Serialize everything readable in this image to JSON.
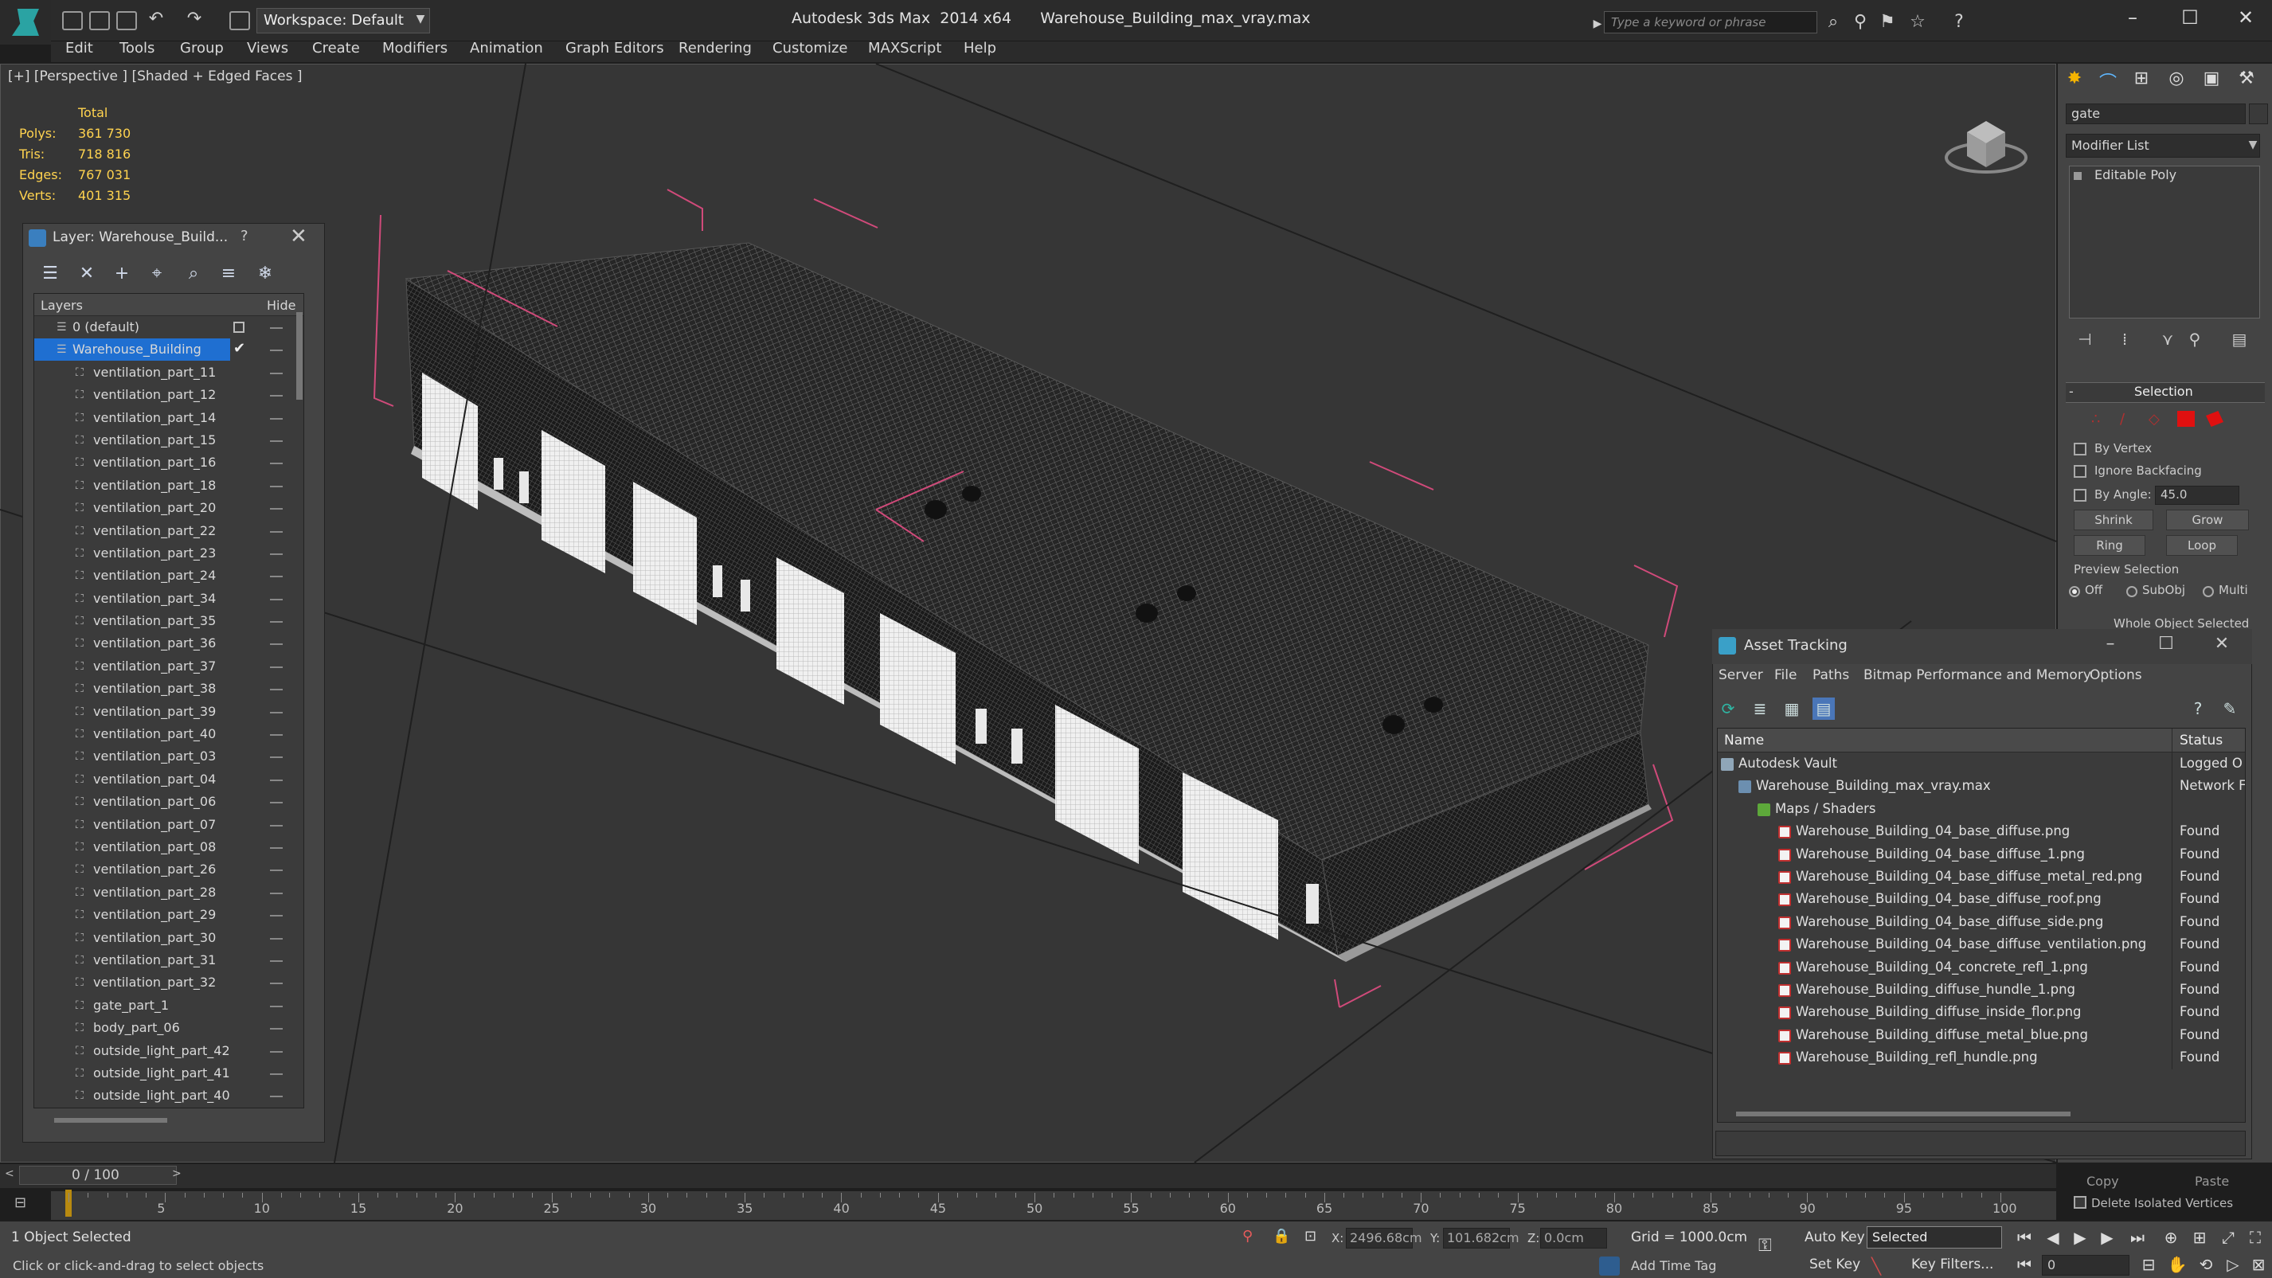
{
  "titlebar": {
    "workspace": "Workspace: Default",
    "title": "Autodesk 3ds Max  2014 x64      Warehouse_Building_max_vray.max",
    "search_placeholder": "Type a keyword or phrase",
    "minimize": "–",
    "maximize": "☐",
    "close": "✕"
  },
  "menu": [
    "Edit",
    "Tools",
    "Group",
    "Views",
    "Create",
    "Modifiers",
    "Animation",
    "Graph Editors",
    "Rendering",
    "Customize",
    "MAXScript",
    "Help"
  ],
  "viewport": {
    "label": "[+] [Perspective ] [Shaded + Edged Faces ]",
    "stats": {
      "header": "Total",
      "rows": [
        {
          "label": "Polys:",
          "value": "361 730"
        },
        {
          "label": "Tris:",
          "value": "718 816"
        },
        {
          "label": "Edges:",
          "value": "767 031"
        },
        {
          "label": "Verts:",
          "value": "401 315"
        }
      ]
    }
  },
  "layer_panel": {
    "title": "Layer: Warehouse_Build...",
    "help": "?",
    "close": "✕",
    "col_layers": "Layers",
    "col_hide": "Hide",
    "top_layers": [
      {
        "name": "0 (default)",
        "selected": false
      },
      {
        "name": "Warehouse_Building",
        "selected": true
      }
    ],
    "items": [
      "ventilation_part_11",
      "ventilation_part_12",
      "ventilation_part_14",
      "ventilation_part_15",
      "ventilation_part_16",
      "ventilation_part_18",
      "ventilation_part_20",
      "ventilation_part_22",
      "ventilation_part_23",
      "ventilation_part_24",
      "ventilation_part_34",
      "ventilation_part_35",
      "ventilation_part_36",
      "ventilation_part_37",
      "ventilation_part_38",
      "ventilation_part_39",
      "ventilation_part_40",
      "ventilation_part_03",
      "ventilation_part_04",
      "ventilation_part_06",
      "ventilation_part_07",
      "ventilation_part_08",
      "ventilation_part_26",
      "ventilation_part_28",
      "ventilation_part_29",
      "ventilation_part_30",
      "ventilation_part_31",
      "ventilation_part_32",
      "gate_part_1",
      "body_part_06",
      "outside_light_part_42",
      "outside_light_part_41",
      "outside_light_part_40"
    ]
  },
  "command_panel": {
    "object_name": "gate",
    "modifier_list": "Modifier List",
    "stack_item": "Editable Poly",
    "selection_title": "Selection",
    "by_vertex": "By Vertex",
    "ignore_backfacing": "Ignore Backfacing",
    "by_angle": "By Angle:",
    "angle_value": "45.0",
    "shrink": "Shrink",
    "grow": "Grow",
    "ring": "Ring",
    "loop": "Loop",
    "preview_selection": "Preview Selection",
    "opt_off": "Off",
    "opt_subobj": "SubObj",
    "opt_multi": "Multi",
    "whole_object": "Whole Object Selected"
  },
  "asset_tracking": {
    "title": "Asset Tracking",
    "menu": [
      "Server",
      "File",
      "Paths",
      "Bitmap Performance and Memory",
      "Options"
    ],
    "col_name": "Name",
    "col_status": "Status",
    "rows": [
      {
        "name": "Autodesk Vault",
        "status": "Logged O",
        "level": 0,
        "icon": "vault-icon"
      },
      {
        "name": "Warehouse_Building_max_vray.max",
        "status": "Network F",
        "level": 1,
        "icon": "max-file-icon"
      },
      {
        "name": "Maps / Shaders",
        "status": "",
        "level": 2,
        "icon": "maps-folder-icon"
      },
      {
        "name": "Warehouse_Building_04_base_diffuse.png",
        "status": "Found",
        "level": 3,
        "icon": "png-icon"
      },
      {
        "name": "Warehouse_Building_04_base_diffuse_1.png",
        "status": "Found",
        "level": 3,
        "icon": "png-icon"
      },
      {
        "name": "Warehouse_Building_04_base_diffuse_metal_red.png",
        "status": "Found",
        "level": 3,
        "icon": "png-icon"
      },
      {
        "name": "Warehouse_Building_04_base_diffuse_roof.png",
        "status": "Found",
        "level": 3,
        "icon": "png-icon"
      },
      {
        "name": "Warehouse_Building_04_base_diffuse_side.png",
        "status": "Found",
        "level": 3,
        "icon": "png-icon"
      },
      {
        "name": "Warehouse_Building_04_base_diffuse_ventilation.png",
        "status": "Found",
        "level": 3,
        "icon": "png-icon"
      },
      {
        "name": "Warehouse_Building_04_concrete_refl_1.png",
        "status": "Found",
        "level": 3,
        "icon": "png-icon"
      },
      {
        "name": "Warehouse_Building_diffuse_hundle_1.png",
        "status": "Found",
        "level": 3,
        "icon": "png-icon"
      },
      {
        "name": "Warehouse_Building_diffuse_inside_flor.png",
        "status": "Found",
        "level": 3,
        "icon": "png-icon"
      },
      {
        "name": "Warehouse_Building_diffuse_metal_blue.png",
        "status": "Found",
        "level": 3,
        "icon": "png-icon"
      },
      {
        "name": "Warehouse_Building_refl_hundle.png",
        "status": "Found",
        "level": 3,
        "icon": "png-icon"
      }
    ]
  },
  "timeline": {
    "frame_label": "0 / 100",
    "ticks": [
      "5",
      "10",
      "15",
      "20",
      "25",
      "30",
      "35",
      "40",
      "45",
      "50",
      "55",
      "60",
      "65",
      "70",
      "75",
      "80",
      "85",
      "90",
      "95",
      "100"
    ]
  },
  "statusbar": {
    "selection": "1 Object Selected",
    "prompt": "Click or click-and-drag to select objects",
    "x_label": "X:",
    "x_value": "2496.68cm",
    "y_label": "Y:",
    "y_value": "101.682cm",
    "z_label": "Z:",
    "z_value": "0.0cm",
    "grid": "Grid = 1000.0cm",
    "auto_key": "Auto Key",
    "set_key": "Set Key",
    "selected_dropdown": "Selected",
    "key_filters": "Key Filters...",
    "add_time_tag": "Add Time Tag",
    "frame_value": "0",
    "copy": "Copy",
    "paste": "Paste",
    "delete_isolated": "Delete Isolated Vertices"
  },
  "colors": {
    "accent_selection": "#1f6fd1",
    "bbox_pink": "#d04a7a",
    "stats_yellow": "#ffd34f"
  }
}
